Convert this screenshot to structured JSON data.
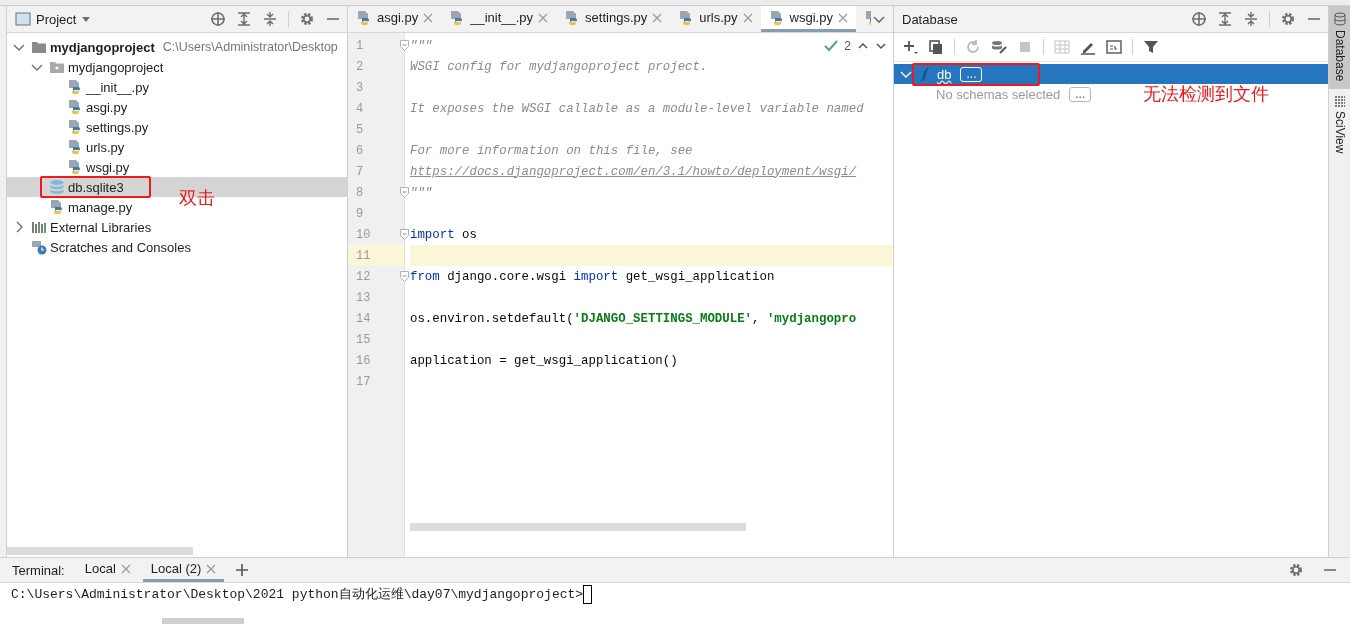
{
  "project_panel": {
    "title": "Project",
    "tree": [
      {
        "label": "mydjangoproject",
        "hint": "C:\\Users\\Administrator\\Desktop",
        "kind": "root",
        "expanded": true,
        "selected": false,
        "children": [
          {
            "label": "mydjangoproject",
            "kind": "package",
            "expanded": true,
            "selected": false,
            "children": [
              {
                "label": "__init__.py",
                "kind": "python",
                "selected": false
              },
              {
                "label": "asgi.py",
                "kind": "python",
                "selected": false
              },
              {
                "label": "settings.py",
                "kind": "python",
                "selected": false
              },
              {
                "label": "urls.py",
                "kind": "python",
                "selected": false
              },
              {
                "label": "wsgi.py",
                "kind": "python",
                "selected": false
              }
            ]
          },
          {
            "label": "db.sqlite3",
            "kind": "database",
            "selected": true
          },
          {
            "label": "manage.py",
            "kind": "python",
            "selected": false
          }
        ]
      },
      {
        "label": "External Libraries",
        "kind": "libraries",
        "expanded": false,
        "selected": false
      },
      {
        "label": "Scratches and Consoles",
        "kind": "scratches",
        "selected": false
      }
    ],
    "annotation": {
      "text": "双击"
    }
  },
  "editor": {
    "tabs": [
      {
        "label": "asgi.py",
        "selected": false
      },
      {
        "label": "__init__.py",
        "selected": false
      },
      {
        "label": "settings.py",
        "selected": false
      },
      {
        "label": "urls.py",
        "selected": false
      },
      {
        "label": "wsgi.py",
        "selected": true
      },
      {
        "kind": "partial",
        "selected": false
      }
    ],
    "inspection_count": "2",
    "lines": [
      {
        "number": "1",
        "fold": true,
        "current": false,
        "tokens": [
          {
            "text": "\"\"\"",
            "kind": "comment"
          }
        ]
      },
      {
        "number": "2",
        "current": false,
        "tokens": [
          {
            "text": "WSGI config for mydjangoproject project.",
            "kind": "comment"
          }
        ]
      },
      {
        "number": "3",
        "current": false
      },
      {
        "number": "4",
        "current": false,
        "tokens": [
          {
            "text": "It exposes the WSGI callable as a module-level variable named",
            "kind": "comment"
          }
        ]
      },
      {
        "number": "5",
        "current": false
      },
      {
        "number": "6",
        "current": false,
        "tokens": [
          {
            "text": "For more information on this file, see",
            "kind": "comment"
          }
        ]
      },
      {
        "number": "7",
        "current": false,
        "tokens": [
          {
            "text": "https://docs.djangoproject.com/en/3.1/howto/deployment/wsgi/",
            "kind": "link"
          }
        ]
      },
      {
        "number": "8",
        "fold": true,
        "current": false,
        "tokens": [
          {
            "text": "\"\"\"",
            "kind": "comment"
          }
        ]
      },
      {
        "number": "9",
        "current": false
      },
      {
        "number": "10",
        "fold": true,
        "current": false,
        "tokens": [
          {
            "text": "import",
            "kind": "keyword"
          },
          {
            "text": " os",
            "kind": "plain"
          }
        ]
      },
      {
        "number": "11",
        "current": true
      },
      {
        "number": "12",
        "fold": true,
        "current": false,
        "tokens": [
          {
            "text": "from",
            "kind": "keyword"
          },
          {
            "text": " django.core.wsgi ",
            "kind": "plain"
          },
          {
            "text": "import",
            "kind": "keyword"
          },
          {
            "text": " get_wsgi_application",
            "kind": "plain"
          }
        ]
      },
      {
        "number": "13",
        "current": false
      },
      {
        "number": "14",
        "current": false,
        "tokens": [
          {
            "text": "os.environ.setdefault(",
            "kind": "plain"
          },
          {
            "text": "'DJANGO_SETTINGS_MODULE'",
            "kind": "string"
          },
          {
            "text": ", ",
            "kind": "plain"
          },
          {
            "text": "'mydjangopro",
            "kind": "string"
          }
        ]
      },
      {
        "number": "15",
        "current": false
      },
      {
        "number": "16",
        "current": false,
        "tokens": [
          {
            "text": "application = get_wsgi_application()",
            "kind": "plain"
          }
        ]
      },
      {
        "number": "17",
        "current": false
      }
    ]
  },
  "database_panel": {
    "title": "Database",
    "tree": [
      {
        "label": "db",
        "kind": "datasource",
        "action": "...",
        "expanded": true,
        "selected": true,
        "children": [
          {
            "label": "No schemas selected",
            "kind": "schemas",
            "action": "...",
            "selected": false
          }
        ]
      }
    ],
    "annotation": {
      "text": "无法检测到文件"
    }
  },
  "right_tool_strip": [
    {
      "label": "Database",
      "kind": "database",
      "selected": true
    },
    {
      "label": "SciView",
      "kind": "sciview",
      "selected": false
    }
  ],
  "terminal": {
    "label": "Terminal:",
    "tabs": [
      {
        "label": "Local",
        "selected": false
      },
      {
        "label": "Local (2)",
        "selected": true
      }
    ],
    "prompt": "C:\\Users\\Administrator\\Desktop\\2021 python自动化运维\\day07\\mydjangoproject>"
  }
}
